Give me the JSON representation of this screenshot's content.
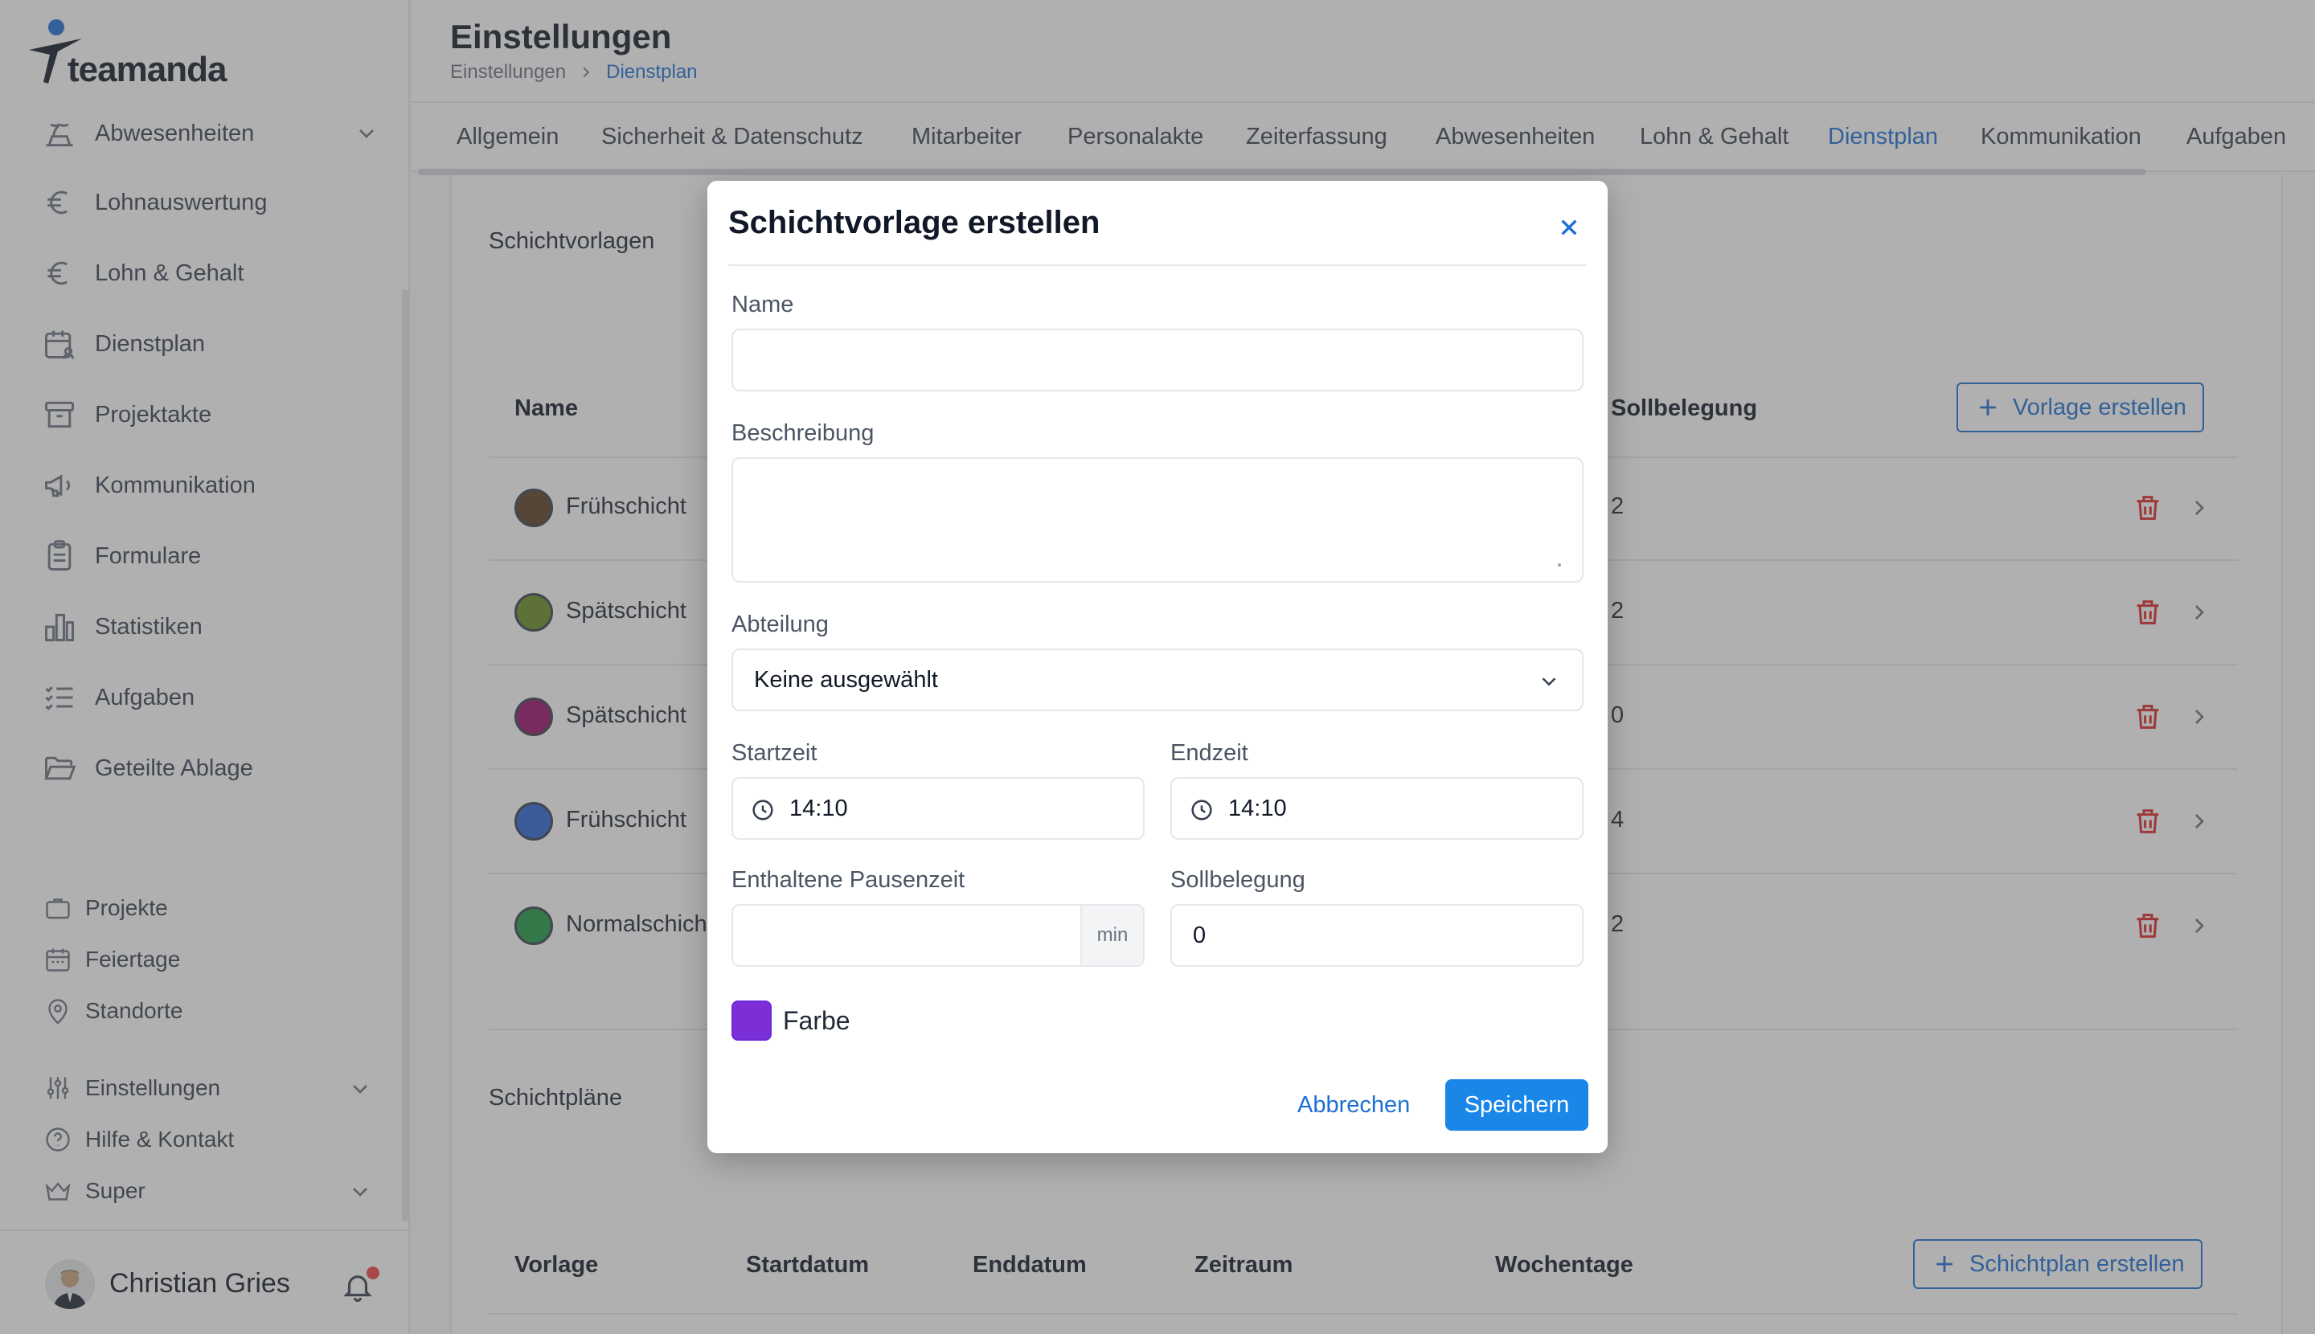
{
  "app": {
    "logo_text": "teamanda"
  },
  "sidebar": {
    "items": [
      {
        "label": "Abwesenheiten",
        "icon": "island-icon"
      },
      {
        "label": "Lohnauswertung",
        "icon": "euro-icon"
      },
      {
        "label": "Lohn & Gehalt",
        "icon": "euro-icon"
      },
      {
        "label": "Dienstplan",
        "icon": "calendar-user-icon"
      },
      {
        "label": "Projektakte",
        "icon": "archive-icon"
      },
      {
        "label": "Kommunikation",
        "icon": "megaphone-icon"
      },
      {
        "label": "Formulare",
        "icon": "clipboard-icon"
      },
      {
        "label": "Statistiken",
        "icon": "bar-chart-icon"
      },
      {
        "label": "Aufgaben",
        "icon": "checklist-icon"
      },
      {
        "label": "Geteilte Ablage",
        "icon": "folder-open-icon"
      }
    ],
    "secondary": [
      {
        "label": "Projekte",
        "icon": "briefcase-icon"
      },
      {
        "label": "Feiertage",
        "icon": "calendar-icon"
      },
      {
        "label": "Standorte",
        "icon": "map-pin-icon"
      },
      {
        "label": "Einstellungen",
        "icon": "sliders-icon"
      },
      {
        "label": "Hilfe & Kontakt",
        "icon": "help-circle-icon"
      },
      {
        "label": "Super",
        "icon": "crown-icon"
      }
    ],
    "user": {
      "name": "Christian Gries"
    }
  },
  "header": {
    "title": "Einstellungen",
    "breadcrumb": [
      "Einstellungen",
      "Dienstplan"
    ]
  },
  "tabs": [
    "Allgemein",
    "Sicherheit & Datenschutz",
    "Mitarbeiter",
    "Personalakte",
    "Zeiterfassung",
    "Abwesenheiten",
    "Lohn & Gehalt",
    "Dienstplan",
    "Kommunikation",
    "Aufgaben"
  ],
  "active_tab": "Dienstplan",
  "templates_section": {
    "label": "Schichtvorlagen",
    "col_name": "Name",
    "col_soll": "Sollbelegung",
    "create_label": "Vorlage erstellen",
    "rows": [
      {
        "name": "Frühschicht",
        "color": "#5b3e1f",
        "soll": "2"
      },
      {
        "name": "Spätschicht",
        "color": "#6b8e23",
        "soll": "2"
      },
      {
        "name": "Spätschicht",
        "color": "#9b0c6b",
        "soll": "0"
      },
      {
        "name": "Frühschicht",
        "color": "#2a64d6",
        "soll": "4"
      },
      {
        "name": "Normalschicht",
        "color": "#1f9a45",
        "soll": "2"
      }
    ]
  },
  "plans_section": {
    "label": "Schichtpläne",
    "cols": [
      "Vorlage",
      "Startdatum",
      "Enddatum",
      "Zeitraum",
      "Wochentage"
    ],
    "create_label": "Schichtplan erstellen"
  },
  "modal": {
    "title": "Schichtvorlage erstellen",
    "name_label": "Name",
    "name_value": "",
    "desc_label": "Beschreibung",
    "desc_value": "",
    "dept_label": "Abteilung",
    "dept_value": "Keine ausgewählt",
    "start_label": "Startzeit",
    "start_value": "14:10",
    "end_label": "Endzeit",
    "end_value": "14:10",
    "pause_label": "Enthaltene Pausenzeit",
    "pause_value": "",
    "pause_unit": "min",
    "soll_label": "Sollbelegung",
    "soll_value": "0",
    "color_label": "Farbe",
    "color_value": "#7c2fd6",
    "cancel_label": "Abbrechen",
    "save_label": "Speichern"
  },
  "colors": {
    "accent": "#1d6fd6",
    "primary_button": "#1a86e8",
    "danger": "#dc2626"
  }
}
